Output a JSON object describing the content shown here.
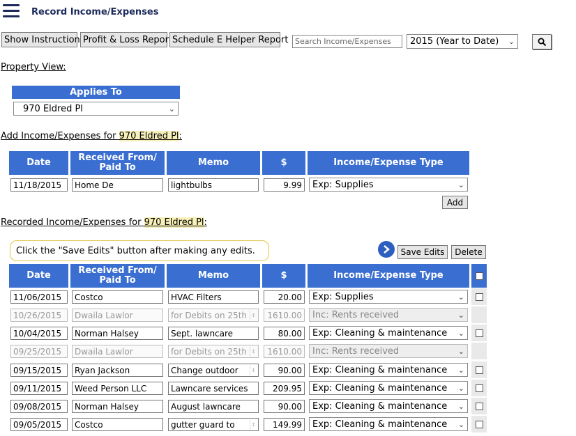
{
  "header": {
    "title": "Record Income/Expenses"
  },
  "toolbar": {
    "show_instructions": "Show Instructions",
    "profit_loss": "Profit & Loss Report",
    "schedule_e": "Schedule E Helper Report",
    "search_placeholder": "Search Income/Expenses",
    "period": "2015 (Year to Date)"
  },
  "property_view": {
    "label": "Property View:",
    "applies_to_header": "Applies To",
    "applies_to_value": "970 Eldred Pl"
  },
  "add_section": {
    "label_prefix": "Add Income/Expenses for ",
    "property": "970 Eldred Pl",
    "label_suffix": ":",
    "add_button": "Add",
    "row": {
      "date": "11/18/2015",
      "from": "Home De",
      "memo": "lightbulbs",
      "amount": "9.99",
      "type": "Exp: Supplies"
    }
  },
  "table_headers": {
    "date": "Date",
    "from_line1": "Received From/",
    "from_line2": "Paid To",
    "memo": "Memo",
    "amount": "$",
    "type": "Income/Expense Type"
  },
  "recorded_section": {
    "label_prefix": "Recorded Income/Expenses for ",
    "property": "970 Eldred Pl",
    "label_suffix": ":",
    "tip": "Click the \"Save Edits\" button after making any edits.",
    "save_button": "Save Edits",
    "delete_button": "Delete",
    "rows": [
      {
        "date": "11/06/2015",
        "from": "Costco",
        "memo": "HVAC Filters",
        "amount": "20.00",
        "type": "Exp: Supplies",
        "disabled": false
      },
      {
        "date": "10/26/2015",
        "from": "Dwaila Lawlor",
        "memo": "for Debits on 25th",
        "amount": "1610.00",
        "type": "Inc: Rents received",
        "disabled": true
      },
      {
        "date": "10/04/2015",
        "from": "Norman Halsey",
        "memo": "Sept. lawncare",
        "amount": "80.00",
        "type": "Exp: Cleaning & maintenance",
        "disabled": false
      },
      {
        "date": "09/25/2015",
        "from": "Dwaila Lawlor",
        "memo": "for Debits on 25th",
        "amount": "1610.00",
        "type": "Inc: Rents received",
        "disabled": true
      },
      {
        "date": "09/15/2015",
        "from": "Ryan Jackson",
        "memo": "Change outdoor",
        "amount": "90.00",
        "type": "Exp: Cleaning & maintenance",
        "disabled": false
      },
      {
        "date": "09/11/2015",
        "from": "Weed Person LLC",
        "memo": "Lawncare services",
        "amount": "209.95",
        "type": "Exp: Cleaning & maintenance",
        "disabled": false
      },
      {
        "date": "09/08/2015",
        "from": "Norman Halsey",
        "memo": "August lawncare",
        "amount": "90.00",
        "type": "Exp: Cleaning & maintenance",
        "disabled": false
      },
      {
        "date": "09/05/2015",
        "from": "Costco",
        "memo": "gutter guard to",
        "amount": "149.99",
        "type": "Exp: Cleaning & maintenance",
        "disabled": false
      }
    ]
  }
}
